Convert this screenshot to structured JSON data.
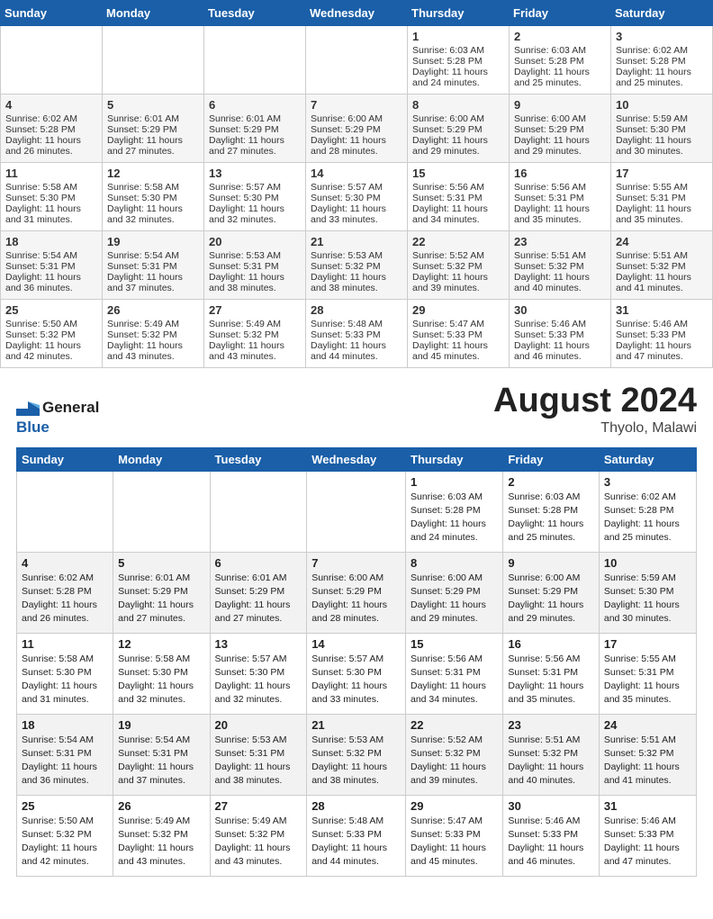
{
  "header": {
    "logo_general": "General",
    "logo_blue": "Blue",
    "month_year": "August 2024",
    "location": "Thyolo, Malawi"
  },
  "days_of_week": [
    "Sunday",
    "Monday",
    "Tuesday",
    "Wednesday",
    "Thursday",
    "Friday",
    "Saturday"
  ],
  "weeks": [
    [
      {
        "day": "",
        "sunrise": "",
        "sunset": "",
        "daylight": ""
      },
      {
        "day": "",
        "sunrise": "",
        "sunset": "",
        "daylight": ""
      },
      {
        "day": "",
        "sunrise": "",
        "sunset": "",
        "daylight": ""
      },
      {
        "day": "",
        "sunrise": "",
        "sunset": "",
        "daylight": ""
      },
      {
        "day": "1",
        "sunrise": "Sunrise: 6:03 AM",
        "sunset": "Sunset: 5:28 PM",
        "daylight": "Daylight: 11 hours and 24 minutes."
      },
      {
        "day": "2",
        "sunrise": "Sunrise: 6:03 AM",
        "sunset": "Sunset: 5:28 PM",
        "daylight": "Daylight: 11 hours and 25 minutes."
      },
      {
        "day": "3",
        "sunrise": "Sunrise: 6:02 AM",
        "sunset": "Sunset: 5:28 PM",
        "daylight": "Daylight: 11 hours and 25 minutes."
      }
    ],
    [
      {
        "day": "4",
        "sunrise": "Sunrise: 6:02 AM",
        "sunset": "Sunset: 5:28 PM",
        "daylight": "Daylight: 11 hours and 26 minutes."
      },
      {
        "day": "5",
        "sunrise": "Sunrise: 6:01 AM",
        "sunset": "Sunset: 5:29 PM",
        "daylight": "Daylight: 11 hours and 27 minutes."
      },
      {
        "day": "6",
        "sunrise": "Sunrise: 6:01 AM",
        "sunset": "Sunset: 5:29 PM",
        "daylight": "Daylight: 11 hours and 27 minutes."
      },
      {
        "day": "7",
        "sunrise": "Sunrise: 6:00 AM",
        "sunset": "Sunset: 5:29 PM",
        "daylight": "Daylight: 11 hours and 28 minutes."
      },
      {
        "day": "8",
        "sunrise": "Sunrise: 6:00 AM",
        "sunset": "Sunset: 5:29 PM",
        "daylight": "Daylight: 11 hours and 29 minutes."
      },
      {
        "day": "9",
        "sunrise": "Sunrise: 6:00 AM",
        "sunset": "Sunset: 5:29 PM",
        "daylight": "Daylight: 11 hours and 29 minutes."
      },
      {
        "day": "10",
        "sunrise": "Sunrise: 5:59 AM",
        "sunset": "Sunset: 5:30 PM",
        "daylight": "Daylight: 11 hours and 30 minutes."
      }
    ],
    [
      {
        "day": "11",
        "sunrise": "Sunrise: 5:58 AM",
        "sunset": "Sunset: 5:30 PM",
        "daylight": "Daylight: 11 hours and 31 minutes."
      },
      {
        "day": "12",
        "sunrise": "Sunrise: 5:58 AM",
        "sunset": "Sunset: 5:30 PM",
        "daylight": "Daylight: 11 hours and 32 minutes."
      },
      {
        "day": "13",
        "sunrise": "Sunrise: 5:57 AM",
        "sunset": "Sunset: 5:30 PM",
        "daylight": "Daylight: 11 hours and 32 minutes."
      },
      {
        "day": "14",
        "sunrise": "Sunrise: 5:57 AM",
        "sunset": "Sunset: 5:30 PM",
        "daylight": "Daylight: 11 hours and 33 minutes."
      },
      {
        "day": "15",
        "sunrise": "Sunrise: 5:56 AM",
        "sunset": "Sunset: 5:31 PM",
        "daylight": "Daylight: 11 hours and 34 minutes."
      },
      {
        "day": "16",
        "sunrise": "Sunrise: 5:56 AM",
        "sunset": "Sunset: 5:31 PM",
        "daylight": "Daylight: 11 hours and 35 minutes."
      },
      {
        "day": "17",
        "sunrise": "Sunrise: 5:55 AM",
        "sunset": "Sunset: 5:31 PM",
        "daylight": "Daylight: 11 hours and 35 minutes."
      }
    ],
    [
      {
        "day": "18",
        "sunrise": "Sunrise: 5:54 AM",
        "sunset": "Sunset: 5:31 PM",
        "daylight": "Daylight: 11 hours and 36 minutes."
      },
      {
        "day": "19",
        "sunrise": "Sunrise: 5:54 AM",
        "sunset": "Sunset: 5:31 PM",
        "daylight": "Daylight: 11 hours and 37 minutes."
      },
      {
        "day": "20",
        "sunrise": "Sunrise: 5:53 AM",
        "sunset": "Sunset: 5:31 PM",
        "daylight": "Daylight: 11 hours and 38 minutes."
      },
      {
        "day": "21",
        "sunrise": "Sunrise: 5:53 AM",
        "sunset": "Sunset: 5:32 PM",
        "daylight": "Daylight: 11 hours and 38 minutes."
      },
      {
        "day": "22",
        "sunrise": "Sunrise: 5:52 AM",
        "sunset": "Sunset: 5:32 PM",
        "daylight": "Daylight: 11 hours and 39 minutes."
      },
      {
        "day": "23",
        "sunrise": "Sunrise: 5:51 AM",
        "sunset": "Sunset: 5:32 PM",
        "daylight": "Daylight: 11 hours and 40 minutes."
      },
      {
        "day": "24",
        "sunrise": "Sunrise: 5:51 AM",
        "sunset": "Sunset: 5:32 PM",
        "daylight": "Daylight: 11 hours and 41 minutes."
      }
    ],
    [
      {
        "day": "25",
        "sunrise": "Sunrise: 5:50 AM",
        "sunset": "Sunset: 5:32 PM",
        "daylight": "Daylight: 11 hours and 42 minutes."
      },
      {
        "day": "26",
        "sunrise": "Sunrise: 5:49 AM",
        "sunset": "Sunset: 5:32 PM",
        "daylight": "Daylight: 11 hours and 43 minutes."
      },
      {
        "day": "27",
        "sunrise": "Sunrise: 5:49 AM",
        "sunset": "Sunset: 5:32 PM",
        "daylight": "Daylight: 11 hours and 43 minutes."
      },
      {
        "day": "28",
        "sunrise": "Sunrise: 5:48 AM",
        "sunset": "Sunset: 5:33 PM",
        "daylight": "Daylight: 11 hours and 44 minutes."
      },
      {
        "day": "29",
        "sunrise": "Sunrise: 5:47 AM",
        "sunset": "Sunset: 5:33 PM",
        "daylight": "Daylight: 11 hours and 45 minutes."
      },
      {
        "day": "30",
        "sunrise": "Sunrise: 5:46 AM",
        "sunset": "Sunset: 5:33 PM",
        "daylight": "Daylight: 11 hours and 46 minutes."
      },
      {
        "day": "31",
        "sunrise": "Sunrise: 5:46 AM",
        "sunset": "Sunset: 5:33 PM",
        "daylight": "Daylight: 11 hours and 47 minutes."
      }
    ]
  ]
}
